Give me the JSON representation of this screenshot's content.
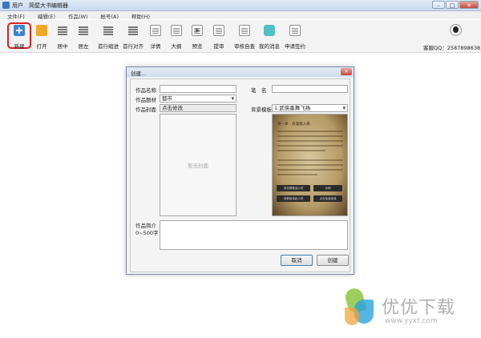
{
  "window": {
    "title_user": "用户",
    "title_app": "简壁大书编辑器",
    "controls": {
      "minimize": "–",
      "maximize": "□",
      "close": "✕"
    }
  },
  "menu": [
    "文件(F)",
    "编辑(E)",
    "作品(W)",
    "帐号(A)",
    "帮助(H)"
  ],
  "toolbar": {
    "items": [
      {
        "label": "新建",
        "icon": "new-icon"
      },
      {
        "label": "打开",
        "icon": "folder-icon"
      },
      {
        "label": "居中",
        "icon": "align-center-icon"
      },
      {
        "label": "居左",
        "icon": "align-left-icon"
      },
      {
        "label": "首行缩进",
        "icon": "indent-icon"
      },
      {
        "label": "首行对齐",
        "icon": "align-icon"
      },
      {
        "label": "详情",
        "icon": "details-icon"
      },
      {
        "label": "大纲",
        "icon": "outline-icon"
      },
      {
        "label": "预览",
        "icon": "preview-icon"
      },
      {
        "label": "提审",
        "icon": "submit-icon"
      },
      {
        "label": "审核自查",
        "icon": "self-check-icon"
      },
      {
        "label": "我的消息",
        "icon": "message-icon"
      },
      {
        "label": "申请签约",
        "icon": "contract-icon"
      }
    ],
    "user_qq": "客服QQ：2587898638"
  },
  "dialog": {
    "title": "创建...",
    "close": "✕",
    "labels": {
      "work_name": "作品名称",
      "work_genre": "作品题材",
      "work_cover": "作品封面",
      "pen_name": "笔　名",
      "bg_template": "背景模板",
      "synopsis": "作品简介",
      "synopsis_limit": "0~500字"
    },
    "values": {
      "work_name": "",
      "genre": "都市",
      "cover_button": "点击修改",
      "pen_name": "",
      "template": "1.武侠墨舞飞扬"
    },
    "cover_placeholder": "暂无封面",
    "preview": {
      "chapter": "第一章　浪漫相入来",
      "buttons": [
        "浏览看看话小说",
        "示例",
        "查看阅读此小说",
        "点击免费阅读"
      ]
    },
    "cancel": "取消",
    "create": "创建"
  },
  "watermark": {
    "text": "优优下载",
    "url": "www.yyxt.com"
  },
  "colors": {
    "highlight_red": "#e02020",
    "dialog_border": "#7a8ea8"
  }
}
